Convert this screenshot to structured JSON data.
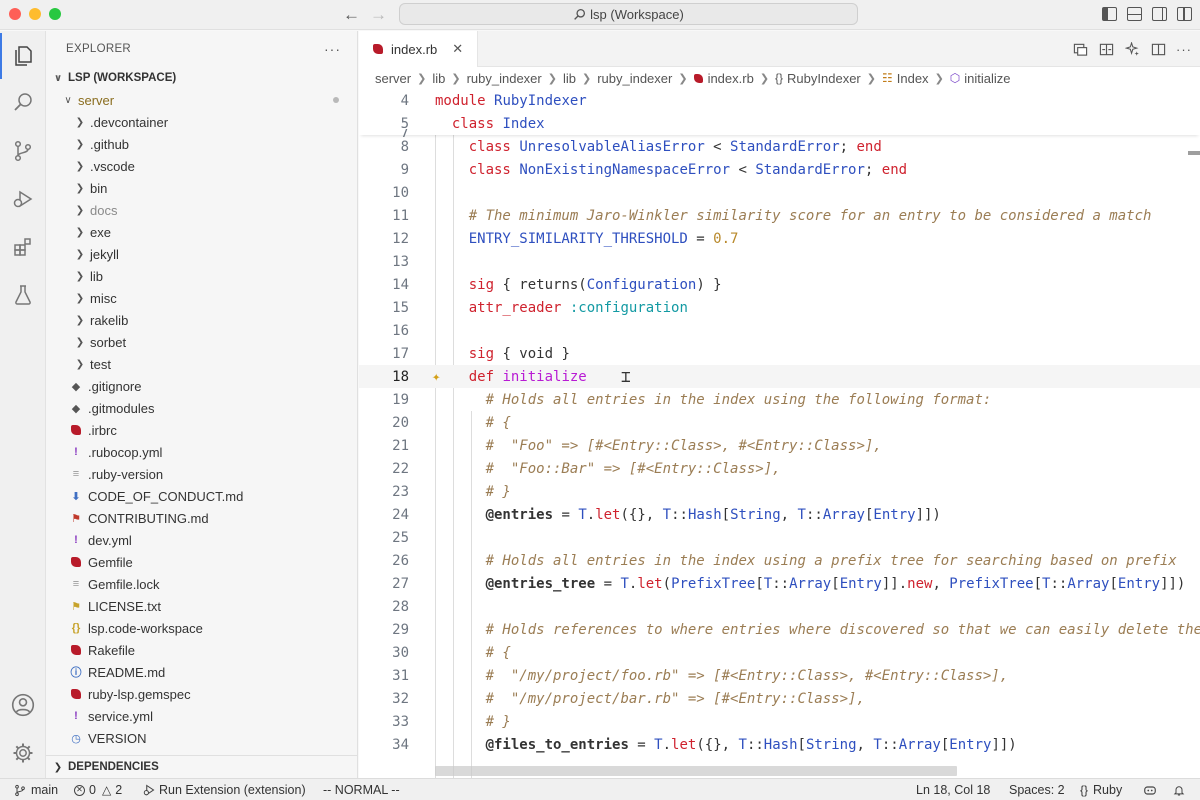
{
  "window": {
    "title": "lsp (Workspace)"
  },
  "sidebar": {
    "header": "EXPLORER",
    "workspace": "LSP (WORKSPACE)",
    "root_folder": "server",
    "items": [
      {
        "label": ".devcontainer",
        "type": "folder"
      },
      {
        "label": ".github",
        "type": "folder"
      },
      {
        "label": ".vscode",
        "type": "folder"
      },
      {
        "label": "bin",
        "type": "folder"
      },
      {
        "label": "docs",
        "type": "folder",
        "dim": true
      },
      {
        "label": "exe",
        "type": "folder"
      },
      {
        "label": "jekyll",
        "type": "folder"
      },
      {
        "label": "lib",
        "type": "folder"
      },
      {
        "label": "misc",
        "type": "folder"
      },
      {
        "label": "rakelib",
        "type": "folder"
      },
      {
        "label": "sorbet",
        "type": "folder"
      },
      {
        "label": "test",
        "type": "folder"
      },
      {
        "label": ".gitignore",
        "type": "git"
      },
      {
        "label": ".gitmodules",
        "type": "git"
      },
      {
        "label": ".irbrc",
        "type": "ruby"
      },
      {
        "label": ".rubocop.yml",
        "type": "yml"
      },
      {
        "label": ".ruby-version",
        "type": "text"
      },
      {
        "label": "CODE_OF_CONDUCT.md",
        "type": "md-down"
      },
      {
        "label": "CONTRIBUTING.md",
        "type": "md-contrib"
      },
      {
        "label": "dev.yml",
        "type": "yml"
      },
      {
        "label": "Gemfile",
        "type": "ruby"
      },
      {
        "label": "Gemfile.lock",
        "type": "text"
      },
      {
        "label": "LICENSE.txt",
        "type": "license"
      },
      {
        "label": "lsp.code-workspace",
        "type": "json"
      },
      {
        "label": "Rakefile",
        "type": "ruby"
      },
      {
        "label": "README.md",
        "type": "info"
      },
      {
        "label": "ruby-lsp.gemspec",
        "type": "ruby"
      },
      {
        "label": "service.yml",
        "type": "yml"
      },
      {
        "label": "VERSION",
        "type": "clock"
      }
    ],
    "dependencies": "DEPENDENCIES"
  },
  "editor": {
    "tab_label": "index.rb",
    "breadcrumb": [
      "server",
      "lib",
      "ruby_indexer",
      "lib",
      "ruby_indexer",
      "index.rb",
      "RubyIndexer",
      "Index",
      "initialize"
    ],
    "lines": [
      {
        "n": "4",
        "html": "<span class='kw'>module</span> <span class='cn'>RubyIndexer</span>"
      },
      {
        "n": "5",
        "html": "  <span class='kw'>class</span> <span class='cn'>Index</span>"
      },
      {
        "n": "7",
        "html": ""
      },
      {
        "n": "8",
        "html": "    <span class='kw'>class</span> <span class='cn'>UnresolvableAliasError</span> &lt; <span class='cn'>StandardError</span>; <span class='kw'>end</span>"
      },
      {
        "n": "9",
        "html": "    <span class='kw'>class</span> <span class='cn'>NonExistingNamespaceError</span> &lt; <span class='cn'>StandardError</span>; <span class='kw'>end</span>"
      },
      {
        "n": "10",
        "html": ""
      },
      {
        "n": "11",
        "html": "    <span class='cm'># The minimum Jaro-Winkler similarity score for an entry to be considered a match</span>"
      },
      {
        "n": "12",
        "html": "    <span class='cn'>ENTRY_SIMILARITY_THRESHOLD</span> = <span class='num'>0.7</span>"
      },
      {
        "n": "13",
        "html": ""
      },
      {
        "n": "14",
        "html": "    <span class='kw'>sig</span> { returns(<span class='cn'>Configuration</span>) }"
      },
      {
        "n": "15",
        "html": "    <span class='kw'>attr_reader</span> <span class='sym'>:configuration</span>"
      },
      {
        "n": "16",
        "html": ""
      },
      {
        "n": "17",
        "html": "    <span class='kw'>sig</span> { void }"
      },
      {
        "n": "18",
        "html": "    <span class='kw'>def</span> <span class='fn'>initialize</span>"
      },
      {
        "n": "19",
        "html": "      <span class='cm'># Holds all entries in the index using the following format:</span>"
      },
      {
        "n": "20",
        "html": "      <span class='cm'># {</span>"
      },
      {
        "n": "21",
        "html": "      <span class='cm'>#  \"Foo\" =&gt; [#&lt;Entry::Class&gt;, #&lt;Entry::Class&gt;],</span>"
      },
      {
        "n": "22",
        "html": "      <span class='cm'>#  \"Foo::Bar\" =&gt; [#&lt;Entry::Class&gt;],</span>"
      },
      {
        "n": "23",
        "html": "      <span class='cm'># }</span>"
      },
      {
        "n": "24",
        "html": "      <span class='ivar'>@entries</span> = <span class='cn'>T</span>.<span class='kw'>let</span>({}, <span class='cn'>T</span>::<span class='cn'>Hash</span>[<span class='cn'>String</span>, <span class='cn'>T</span>::<span class='cn'>Array</span>[<span class='cn'>Entry</span>]])"
      },
      {
        "n": "25",
        "html": ""
      },
      {
        "n": "26",
        "html": "      <span class='cm'># Holds all entries in the index using a prefix tree for searching based on prefix</span>"
      },
      {
        "n": "27",
        "html": "      <span class='ivar'>@entries_tree</span> = <span class='cn'>T</span>.<span class='kw'>let</span>(<span class='cn'>PrefixTree</span>[<span class='cn'>T</span>::<span class='cn'>Array</span>[<span class='cn'>Entry</span>]].<span class='kw'>new</span>, <span class='cn'>PrefixTree</span>[<span class='cn'>T</span>::<span class='cn'>Array</span>[<span class='cn'>Entry</span>]])"
      },
      {
        "n": "28",
        "html": ""
      },
      {
        "n": "29",
        "html": "      <span class='cm'># Holds references to where entries where discovered so that we can easily delete them</span>"
      },
      {
        "n": "30",
        "html": "      <span class='cm'># {</span>"
      },
      {
        "n": "31",
        "html": "      <span class='cm'>#  \"/my/project/foo.rb\" =&gt; [#&lt;Entry::Class&gt;, #&lt;Entry::Class&gt;],</span>"
      },
      {
        "n": "32",
        "html": "      <span class='cm'>#  \"/my/project/bar.rb\" =&gt; [#&lt;Entry::Class&gt;],</span>"
      },
      {
        "n": "33",
        "html": "      <span class='cm'># }</span>"
      },
      {
        "n": "34",
        "html": "      <span class='ivar'>@files_to_entries</span> = <span class='cn'>T</span>.<span class='kw'>let</span>({}, <span class='cn'>T</span>::<span class='cn'>Hash</span>[<span class='cn'>String</span>, <span class='cn'>T</span>::<span class='cn'>Array</span>[<span class='cn'>Entry</span>]])"
      }
    ],
    "current_line": "18"
  },
  "statusbar": {
    "branch": "main",
    "errors": "0",
    "warnings": "2",
    "run": "Run Extension (extension)",
    "mode": "-- NORMAL --",
    "position": "Ln 18, Col 18",
    "spaces": "Spaces: 2",
    "language": "Ruby"
  }
}
